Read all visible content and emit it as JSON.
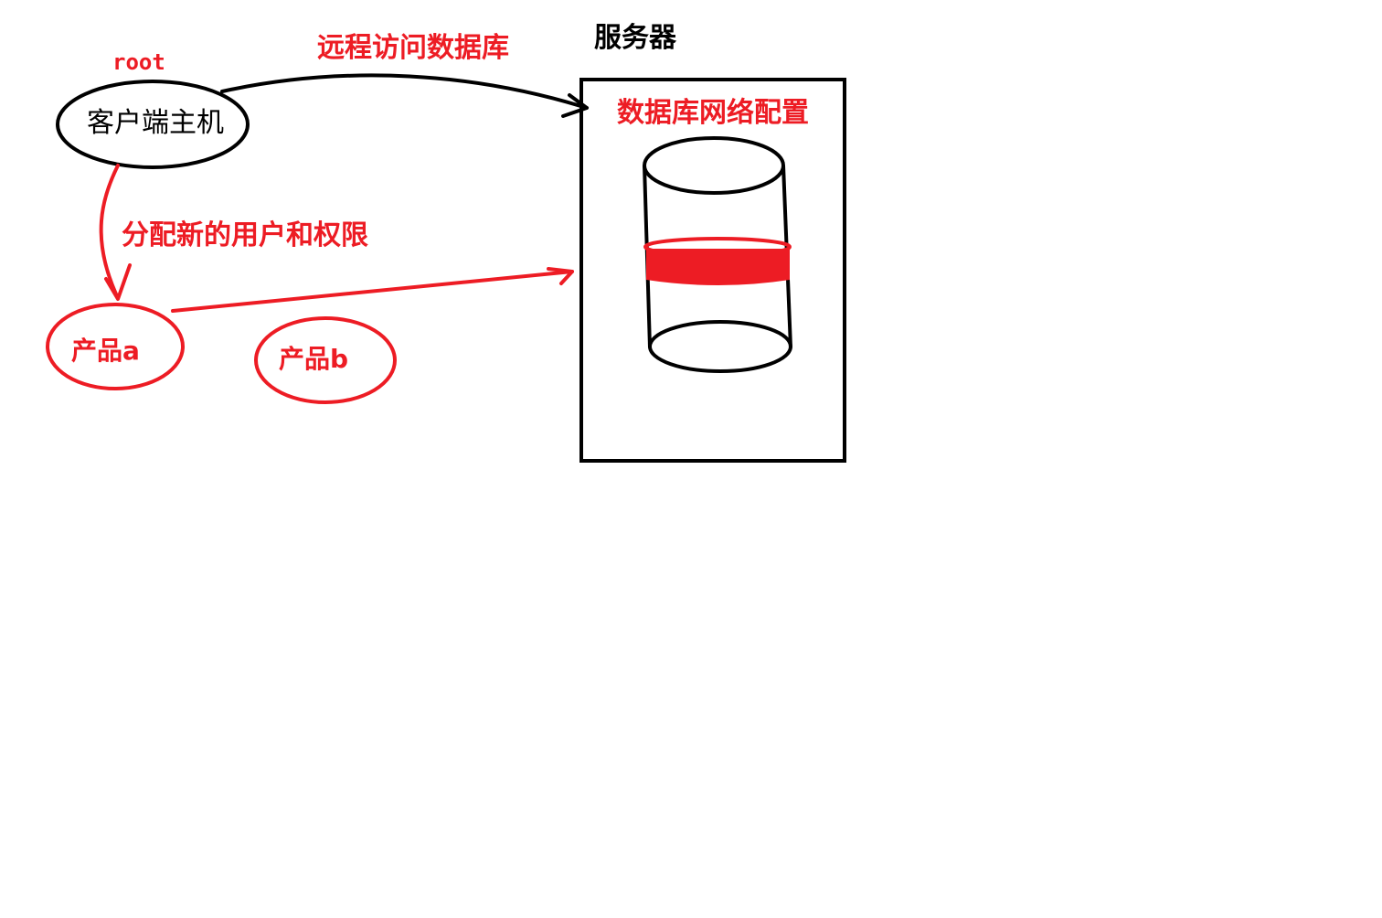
{
  "labels": {
    "root": "root",
    "remote_access": "远程访问数据库",
    "server": "服务器",
    "db_network_config": "数据库网络配置",
    "client_host": "客户端主机",
    "assign_user": "分配新的用户和权限",
    "product_a": "产品a",
    "product_b": "产品b"
  },
  "colors": {
    "ink": "#000000",
    "accent": "#ed1c24",
    "background": "#ffffff"
  }
}
